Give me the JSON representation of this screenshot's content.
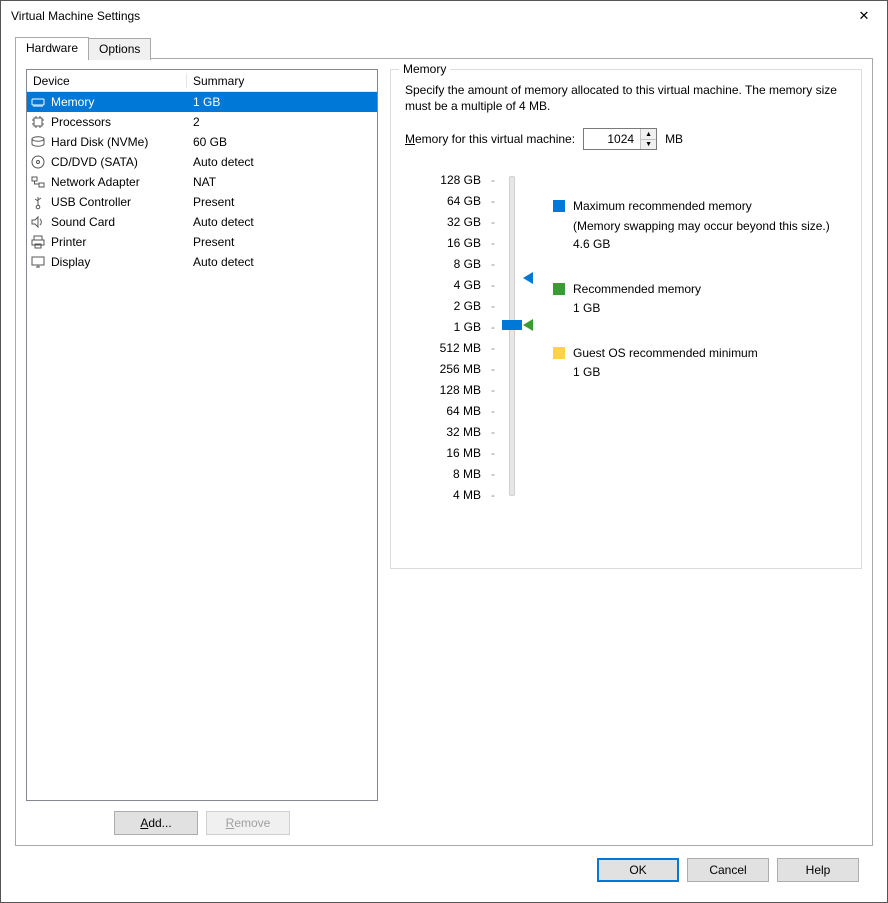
{
  "window": {
    "title": "Virtual Machine Settings"
  },
  "tabs": {
    "hardware": "Hardware",
    "options": "Options"
  },
  "deviceList": {
    "headerDevice": "Device",
    "headerSummary": "Summary",
    "rows": [
      {
        "name": "Memory",
        "summary": "1 GB",
        "icon": "memory-icon"
      },
      {
        "name": "Processors",
        "summary": "2",
        "icon": "cpu-icon"
      },
      {
        "name": "Hard Disk (NVMe)",
        "summary": "60 GB",
        "icon": "hard-disk-icon"
      },
      {
        "name": "CD/DVD (SATA)",
        "summary": "Auto detect",
        "icon": "optical-icon"
      },
      {
        "name": "Network Adapter",
        "summary": "NAT",
        "icon": "network-icon"
      },
      {
        "name": "USB Controller",
        "summary": "Present",
        "icon": "usb-icon"
      },
      {
        "name": "Sound Card",
        "summary": "Auto detect",
        "icon": "sound-icon"
      },
      {
        "name": "Printer",
        "summary": "Present",
        "icon": "printer-icon"
      },
      {
        "name": "Display",
        "summary": "Auto detect",
        "icon": "display-icon"
      }
    ]
  },
  "buttons": {
    "add": "Add...",
    "remove": "Remove",
    "ok": "OK",
    "cancel": "Cancel",
    "help": "Help"
  },
  "memoryPanel": {
    "legend": "Memory",
    "description": "Specify the amount of memory allocated to this virtual machine. The memory size must be a multiple of 4 MB.",
    "inputLabelPrefix": "M",
    "inputLabelRest": "emory for this virtual machine:",
    "valueMB": "1024",
    "unit": "MB",
    "ticks": [
      "128 GB",
      "64 GB",
      "32 GB",
      "16 GB",
      "8 GB",
      "4 GB",
      "2 GB",
      "1 GB",
      "512 MB",
      "256 MB",
      "128 MB",
      "64 MB",
      "32 MB",
      "16 MB",
      "8 MB",
      "4 MB"
    ],
    "legendItems": {
      "max": {
        "label": "Maximum recommended memory",
        "sub": "(Memory swapping may occur beyond this size.)",
        "value": "4.6 GB"
      },
      "rec": {
        "label": "Recommended memory",
        "value": "1 GB"
      },
      "min": {
        "label": "Guest OS recommended minimum",
        "value": "1 GB"
      }
    }
  }
}
